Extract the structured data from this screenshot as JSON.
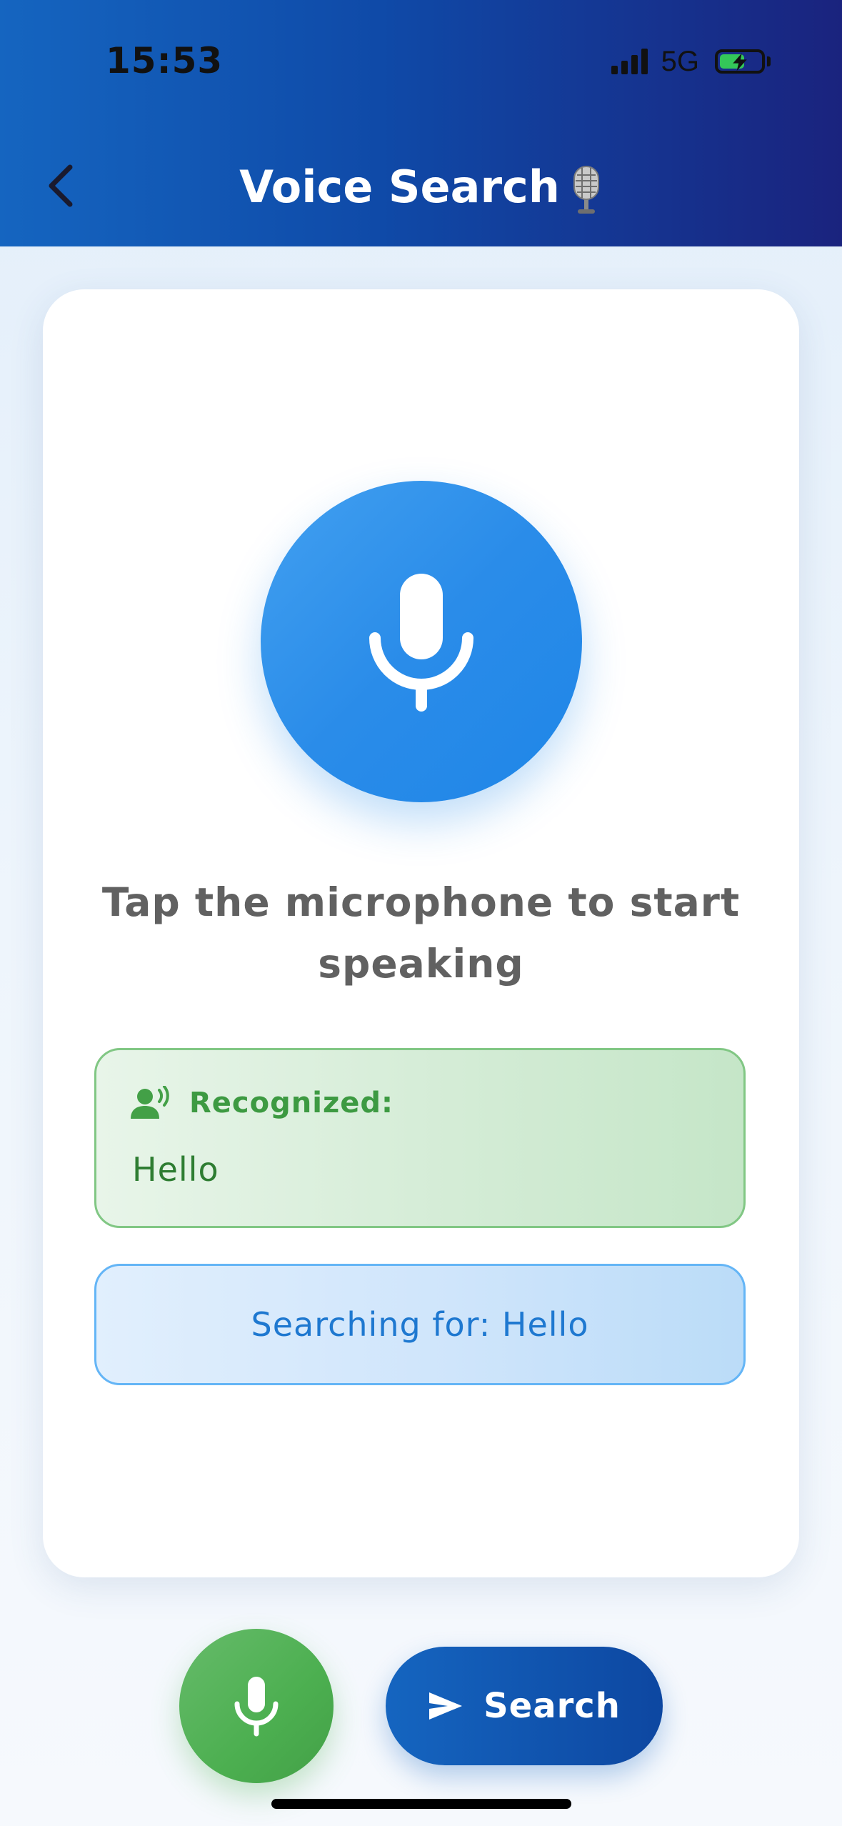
{
  "status_bar": {
    "time": "15:53",
    "network": "5G",
    "battery_level": 0.6
  },
  "header": {
    "title": "Voice Search",
    "title_emoji": "studio-microphone-icon",
    "colors": {
      "start": "#1565c0",
      "end": "#1a237e"
    }
  },
  "main": {
    "mic_button_icon": "microphone-icon",
    "prompt": "Tap the microphone to start speaking",
    "recognized": {
      "icon": "voice-person-icon",
      "label": "Recognized:",
      "text": "Hello"
    },
    "searching": {
      "text": "Searching for: Hello"
    }
  },
  "bottom": {
    "mic_fab_icon": "microphone-icon",
    "search_button": {
      "icon": "send-icon",
      "label": "Search"
    }
  },
  "colors": {
    "primary_blue": "#2196f3",
    "dark_blue": "#0d47a1",
    "success_green": "#4caf50",
    "recognized_text": "#2e7d32",
    "searching_text": "#1e78d0"
  }
}
